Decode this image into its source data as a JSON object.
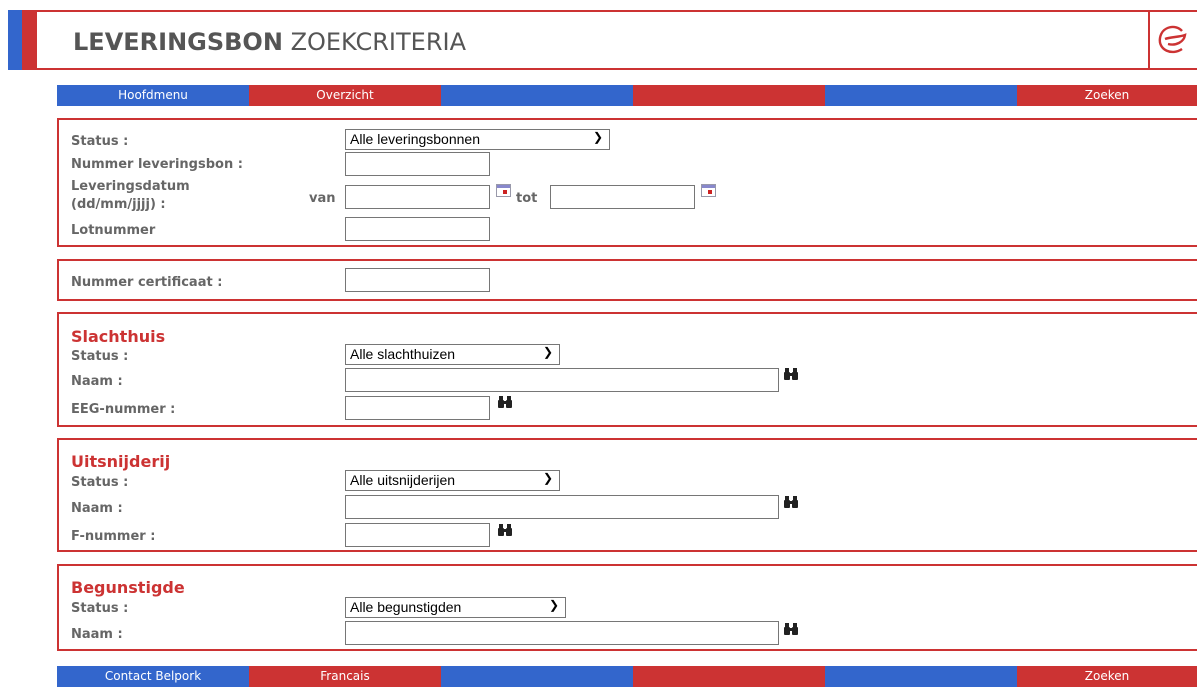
{
  "header": {
    "title_bold": "LEVERINGSBON",
    "title_normal": "ZOEKCRITERIA",
    "logo_icon": "brand-logo-icon"
  },
  "top_nav": [
    "Hoofdmenu",
    "Overzicht",
    "",
    "",
    "",
    "Zoeken"
  ],
  "bottom_nav": [
    "Contact Belpork",
    "Francais",
    "",
    "",
    "",
    "Zoeken"
  ],
  "colors": {
    "blue": "#3366cc",
    "red": "#cc3333",
    "label": "#666666"
  },
  "delivery": {
    "status_label": "Status :",
    "status_value": "Alle leveringsbonnen",
    "number_label": "Nummer leveringsbon :",
    "date_label_1": "Leveringsdatum",
    "date_label_2": "(dd/mm/jjjj) :",
    "from_label": "van",
    "to_label": "tot",
    "lot_label": "Lotnummer"
  },
  "certificate": {
    "label": "Nummer certificaat :"
  },
  "slaughterhouse": {
    "title": "Slachthuis",
    "status_label": "Status :",
    "status_value": "Alle slachthuizen",
    "name_label": "Naam :",
    "eeg_label": "EEG-nummer :"
  },
  "cutting": {
    "title": "Uitsnijderij",
    "status_label": "Status :",
    "status_value": "Alle uitsnijderijen",
    "name_label": "Naam :",
    "f_label": "F-nummer :"
  },
  "beneficiary": {
    "title": "Begunstigde",
    "status_label": "Status :",
    "status_value": "Alle begunstigden",
    "name_label": "Naam :"
  }
}
